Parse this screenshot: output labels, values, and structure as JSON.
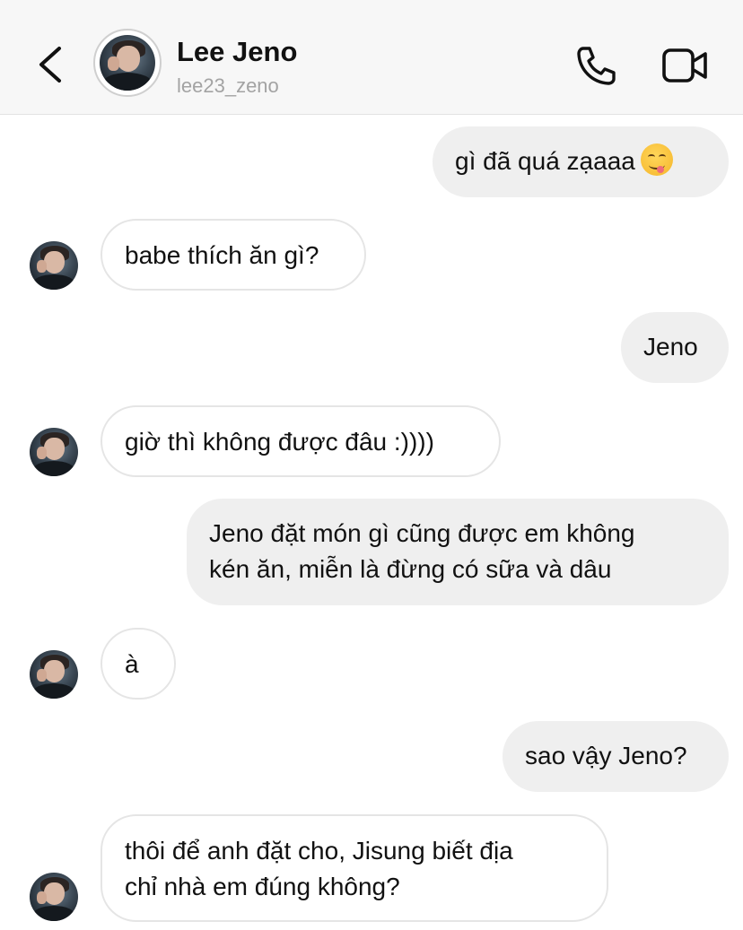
{
  "header": {
    "name": "Lee Jeno",
    "username": "lee23_zeno"
  },
  "messages": [
    {
      "direction": "outgoing",
      "lines": [
        "gì đã quá zạaaa"
      ],
      "emoji": "savoring-food-emoji"
    },
    {
      "direction": "incoming",
      "lines": [
        "babe thích ăn gì?"
      ]
    },
    {
      "direction": "outgoing",
      "lines": [
        "Jeno"
      ]
    },
    {
      "direction": "incoming",
      "lines": [
        "giờ thì không được đâu :))))"
      ]
    },
    {
      "direction": "outgoing",
      "lines": [
        "Jeno đặt món gì cũng được em không",
        "kén ăn, miễn là đừng có sữa và dâu"
      ]
    },
    {
      "direction": "incoming",
      "lines": [
        "à"
      ]
    },
    {
      "direction": "outgoing",
      "lines": [
        "sao vậy Jeno?"
      ]
    },
    {
      "direction": "incoming",
      "lines": [
        "thôi để anh đặt cho, Jisung biết địa",
        "chỉ nhà em đúng không?"
      ]
    }
  ],
  "icons": {
    "back": "chevron-left-icon",
    "call": "phone-icon",
    "video": "video-camera-icon"
  },
  "colors": {
    "header_bg": "#f7f7f7",
    "outgoing_bubble": "#efefef",
    "incoming_border": "#e5e5e5",
    "username": "#a3a3a3"
  }
}
